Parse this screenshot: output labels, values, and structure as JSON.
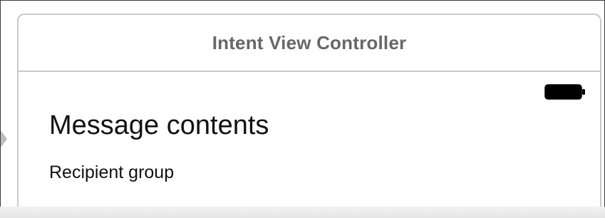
{
  "scene": {
    "title": "Intent View Controller"
  },
  "content": {
    "message_title": "Message contents",
    "recipient_label": "Recipient group"
  },
  "status_bar": {
    "battery_icon": "battery-full-icon"
  },
  "colors": {
    "scene_border": "#c9c9c9",
    "title_text": "#676767",
    "body_text": "#111111",
    "entry_arrow": "#bdbdbd"
  }
}
